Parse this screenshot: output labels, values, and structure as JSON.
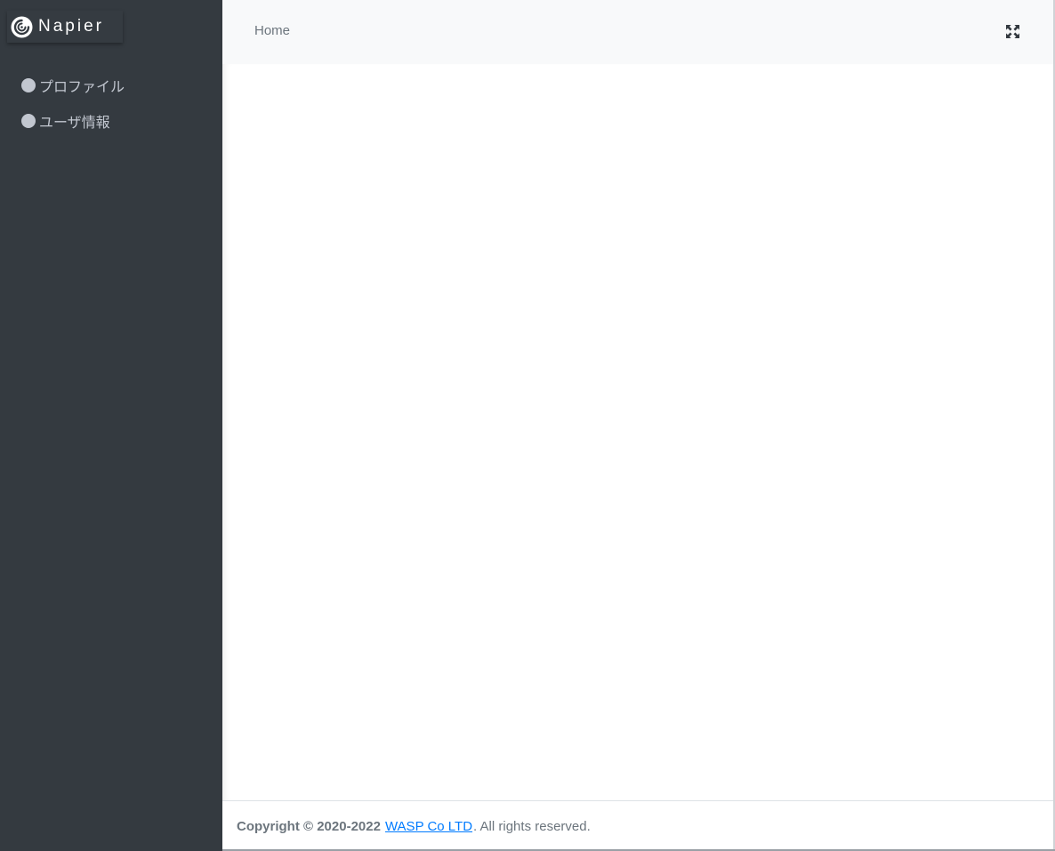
{
  "brand": {
    "name": "Napier",
    "logo_icon": "swirl-logo-icon"
  },
  "sidebar": {
    "items": [
      {
        "label": "プロファイル",
        "icon": "circle-icon"
      },
      {
        "label": "ユーザ情報",
        "icon": "circle-icon"
      }
    ]
  },
  "topbar": {
    "home_label": "Home",
    "fullscreen_icon": "expand-icon"
  },
  "footer": {
    "copyright_prefix": "Copyright © 2020-2022",
    "company_link": "WASP Co LTD",
    "suffix": ". All rights reserved."
  },
  "colors": {
    "sidebar_bg": "#343a40",
    "sidebar_text": "#c2c7d0",
    "topbar_bg": "#f8f9fa",
    "link": "#007bff"
  }
}
